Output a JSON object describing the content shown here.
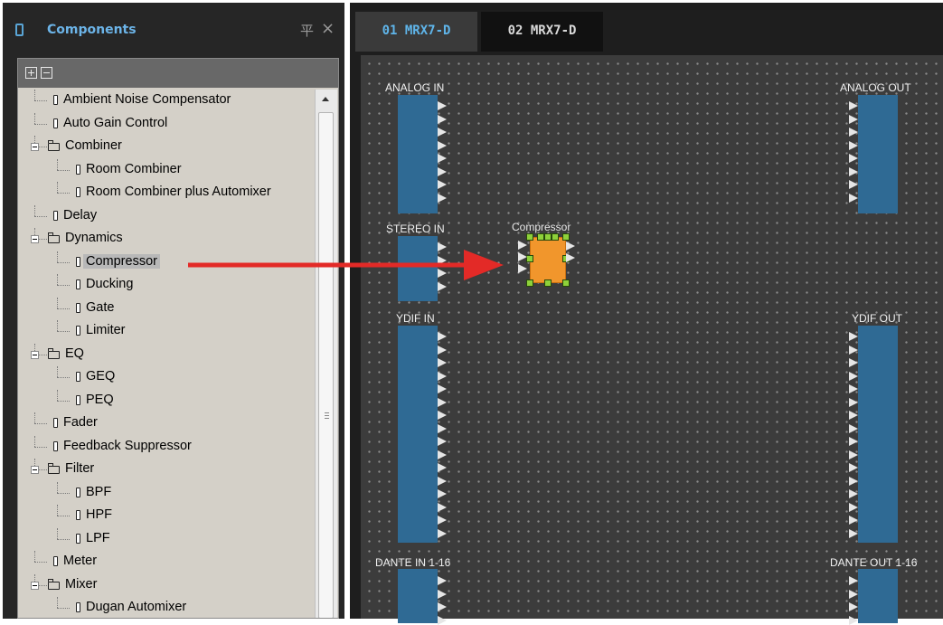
{
  "components_panel": {
    "title": "Components",
    "pin_glyph": "平",
    "close_glyph": "×"
  },
  "tree": {
    "items": [
      {
        "label": "Ambient Noise Compensator",
        "type": "component",
        "level": 0
      },
      {
        "label": "Auto Gain Control",
        "type": "component",
        "level": 0
      },
      {
        "label": "Combiner",
        "type": "folder",
        "level": 0
      },
      {
        "label": "Room Combiner",
        "type": "component",
        "level": 1
      },
      {
        "label": "Room Combiner plus Automixer",
        "type": "component",
        "level": 1
      },
      {
        "label": "Delay",
        "type": "component",
        "level": 0
      },
      {
        "label": "Dynamics",
        "type": "folder",
        "level": 0
      },
      {
        "label": "Compressor",
        "type": "component",
        "level": 1,
        "selected": true
      },
      {
        "label": "Ducking",
        "type": "component",
        "level": 1
      },
      {
        "label": "Gate",
        "type": "component",
        "level": 1
      },
      {
        "label": "Limiter",
        "type": "component",
        "level": 1
      },
      {
        "label": "EQ",
        "type": "folder",
        "level": 0
      },
      {
        "label": "GEQ",
        "type": "component",
        "level": 1
      },
      {
        "label": "PEQ",
        "type": "component",
        "level": 1
      },
      {
        "label": "Fader",
        "type": "component",
        "level": 0
      },
      {
        "label": "Feedback Suppressor",
        "type": "component",
        "level": 0
      },
      {
        "label": "Filter",
        "type": "folder",
        "level": 0
      },
      {
        "label": "BPF",
        "type": "component",
        "level": 1
      },
      {
        "label": "HPF",
        "type": "component",
        "level": 1
      },
      {
        "label": "LPF",
        "type": "component",
        "level": 1
      },
      {
        "label": "Meter",
        "type": "component",
        "level": 0
      },
      {
        "label": "Mixer",
        "type": "folder",
        "level": 0
      },
      {
        "label": "Dugan Automixer",
        "type": "component",
        "level": 1
      }
    ]
  },
  "tabs": [
    {
      "label": "01 MRX7-D",
      "active": true
    },
    {
      "label": "02 MRX7-D",
      "active": false
    }
  ],
  "blocks": {
    "analog_in": "ANALOG IN",
    "analog_out": "ANALOG OUT",
    "stereo_in": "STEREO IN",
    "ydif_in": "YDIF IN",
    "ydif_out": "YDIF OUT",
    "dante_in": "DANTE IN 1-16",
    "dante_out": "DANTE OUT 1-16",
    "compressor": "Compressor"
  },
  "colors": {
    "panel_bg": "#262626",
    "title_blue": "#6cb4e8",
    "tree_bg": "#d4d0c8",
    "canvas_bg": "#3c3c3c",
    "io_block": "#2f6a94",
    "compressor": "#f1962c",
    "handle": "#8ed13a",
    "arrow": "#e32a27"
  }
}
